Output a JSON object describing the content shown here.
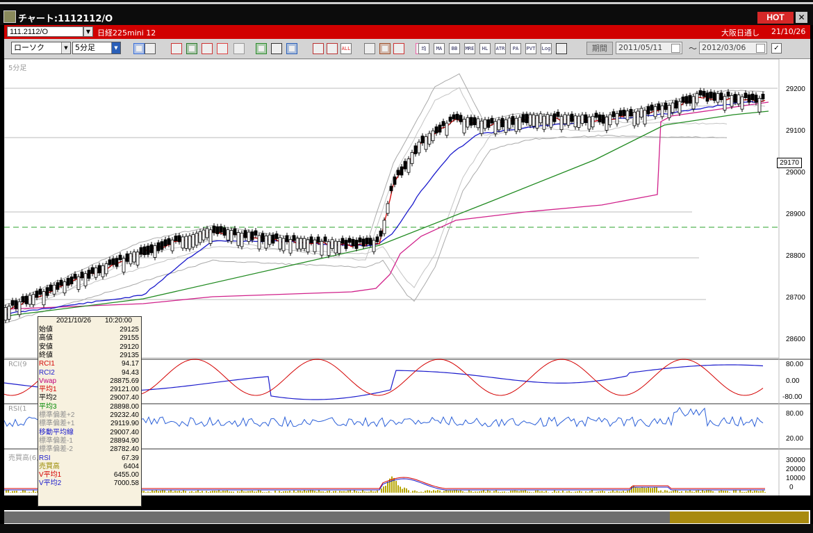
{
  "window": {
    "title": "チャート:1112112/O",
    "hot": "HOT",
    "close": "✕"
  },
  "symbol": {
    "code": "111.2112/O",
    "name": "日経225mini 12",
    "session": "大阪日通し",
    "date": "21/10/26"
  },
  "toolbar": {
    "chart_type": "ローソク",
    "interval": "5分足",
    "period_label": "期間",
    "date_from": "2011/05/11",
    "date_to": "2012/03/06",
    "range_sep": "〜",
    "icons": [
      {
        "name": "zoom-icon",
        "text": ""
      },
      {
        "name": "crosshair-icon",
        "text": ""
      },
      {
        "name": "draw-icon",
        "text": ""
      },
      {
        "name": "magnify-chart-icon",
        "text": ""
      },
      {
        "name": "reset-icon",
        "text": ""
      },
      {
        "name": "split-icon",
        "text": ""
      },
      {
        "name": "warning-icon",
        "text": ""
      },
      {
        "name": "pen-icon",
        "text": ""
      },
      {
        "name": "cursor-icon",
        "text": ""
      },
      {
        "name": "undo-icon",
        "text": ""
      },
      {
        "name": "candle-icon",
        "text": ""
      },
      {
        "name": "candle-alt-icon",
        "text": ""
      },
      {
        "name": "all-icon",
        "text": "ALL"
      },
      {
        "name": "fish-icon",
        "text": ""
      },
      {
        "name": "gear-icon",
        "text": ""
      },
      {
        "name": "pencil-icon",
        "text": ""
      },
      {
        "name": "palette-icon",
        "text": ""
      },
      {
        "name": "ichimoku-icon",
        "text": "均"
      },
      {
        "name": "ma-icon",
        "text": "MA"
      },
      {
        "name": "bb-icon",
        "text": "BB"
      },
      {
        "name": "mre-icon",
        "text": "MRE"
      },
      {
        "name": "hl-icon",
        "text": "HL"
      },
      {
        "name": "atr-icon",
        "text": "ATR"
      },
      {
        "name": "para-icon",
        "text": "PA"
      },
      {
        "name": "pvt-icon",
        "text": "PVT"
      },
      {
        "name": "log-icon",
        "text": "Log"
      },
      {
        "name": "window-icon",
        "text": ""
      }
    ]
  },
  "chart": {
    "pane_labels": {
      "main": "5分足",
      "rci": "RCI(9",
      "rsi": "RSI(1",
      "volume": "売買高(6,12,24)"
    },
    "last_price": "29170",
    "price_ticks": [
      "29200",
      "29100",
      "29000",
      "28900",
      "28800",
      "28700",
      "28600"
    ],
    "rci_ticks": [
      "80.00",
      "0.00",
      "-80.00"
    ],
    "rsi_ticks": [
      "80.00",
      "20.00"
    ],
    "vol_ticks": [
      "30000",
      "20000",
      "10000",
      "0"
    ],
    "x_ticks": [
      {
        "label": "22",
        "bold": false
      },
      {
        "label": "1",
        "bold": false
      },
      {
        "label": "4",
        "bold": false
      },
      {
        "label": "26/8:45",
        "bold": true
      },
      {
        "label": "11",
        "bold": false
      },
      {
        "label": "14",
        "bold": false
      },
      {
        "label": "16:30",
        "bold": true
      },
      {
        "label": "19",
        "bold": false
      }
    ]
  },
  "data_window": {
    "date": "2021/10/26",
    "time": "10:20:00",
    "rows": [
      {
        "label": "始値",
        "value": "29125",
        "color": "#000000"
      },
      {
        "label": "高値",
        "value": "29155",
        "color": "#000000"
      },
      {
        "label": "安値",
        "value": "29120",
        "color": "#000000"
      },
      {
        "label": "終値",
        "value": "29135",
        "color": "#000000"
      },
      {
        "label": "RCI1",
        "value": "94.17",
        "color": "#d40000"
      },
      {
        "label": "RCI2",
        "value": "94.43",
        "color": "#1a1acc"
      },
      {
        "label": "Vwap",
        "value": "28875.69",
        "color": "#c0007a"
      },
      {
        "label": "平均1",
        "value": "29121.00",
        "color": "#d40000"
      },
      {
        "label": "平均2",
        "value": "29007.40",
        "color": "#000000"
      },
      {
        "label": "平均3",
        "value": "28898.00",
        "color": "#008800"
      },
      {
        "label": "標準偏差+2",
        "value": "29232.40",
        "color": "#909090"
      },
      {
        "label": "標準偏差+1",
        "value": "29119.90",
        "color": "#909090"
      },
      {
        "label": "移動平均線",
        "value": "29007.40",
        "color": "#1a1acc"
      },
      {
        "label": "標準偏差-1",
        "value": "28894.90",
        "color": "#909090"
      },
      {
        "label": "標準偏差-2",
        "value": "28782.40",
        "color": "#909090"
      },
      {
        "label": "RSI",
        "value": "67.39",
        "color": "#1a1acc"
      },
      {
        "label": "売買高",
        "value": "6404",
        "color": "#9a8a00"
      },
      {
        "label": "V平均1",
        "value": "6455.00",
        "color": "#d40000"
      },
      {
        "label": "V平均2",
        "value": "7000.58",
        "color": "#1a1acc"
      }
    ]
  }
}
